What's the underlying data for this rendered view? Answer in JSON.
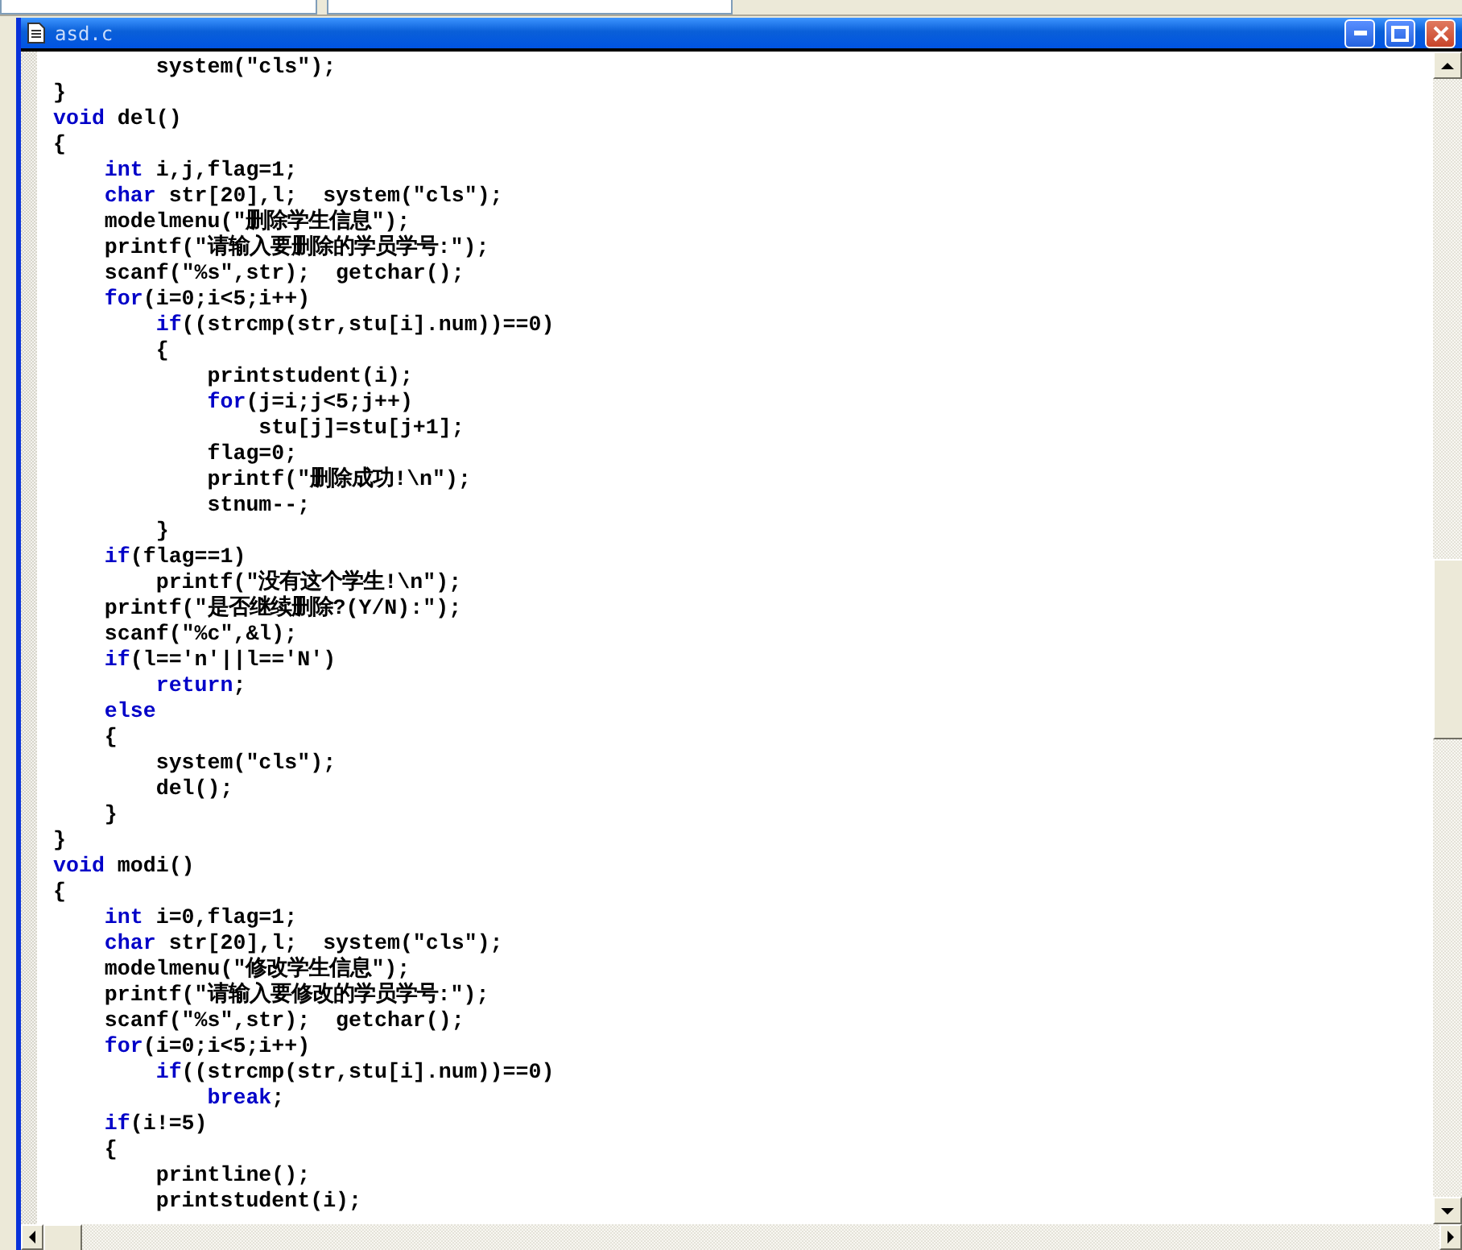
{
  "window": {
    "title": "asd.c"
  },
  "editor": {
    "lines": [
      {
        "tokens": [
          {
            "kind": "code",
            "text": "        system(\"cls\");"
          }
        ]
      },
      {
        "tokens": [
          {
            "kind": "code",
            "text": "}"
          }
        ]
      },
      {
        "tokens": [
          {
            "kind": "keyword",
            "text": "void"
          },
          {
            "kind": "code",
            "text": " del()"
          }
        ]
      },
      {
        "tokens": [
          {
            "kind": "code",
            "text": "{"
          }
        ]
      },
      {
        "tokens": [
          {
            "kind": "keyword",
            "text": "    int"
          },
          {
            "kind": "code",
            "text": " i,j,flag=1;"
          }
        ]
      },
      {
        "tokens": [
          {
            "kind": "keyword",
            "text": "    char"
          },
          {
            "kind": "code",
            "text": " str[20],l;  system(\"cls\");"
          }
        ]
      },
      {
        "tokens": [
          {
            "kind": "code",
            "text": "    modelmenu(\"删除学生信息\");"
          }
        ]
      },
      {
        "tokens": [
          {
            "kind": "code",
            "text": "    printf(\"请输入要删除的学员学号:\");"
          }
        ]
      },
      {
        "tokens": [
          {
            "kind": "code",
            "text": "    scanf(\"%s\",str);  getchar();"
          }
        ]
      },
      {
        "tokens": [
          {
            "kind": "keyword",
            "text": "    for"
          },
          {
            "kind": "code",
            "text": "(i=0;i<5;i++)"
          }
        ]
      },
      {
        "tokens": [
          {
            "kind": "keyword",
            "text": "        if"
          },
          {
            "kind": "code",
            "text": "((strcmp(str,stu[i].num))==0)"
          }
        ]
      },
      {
        "tokens": [
          {
            "kind": "code",
            "text": "        {"
          }
        ]
      },
      {
        "tokens": [
          {
            "kind": "code",
            "text": "            printstudent(i);"
          }
        ]
      },
      {
        "tokens": [
          {
            "kind": "keyword",
            "text": "            for"
          },
          {
            "kind": "code",
            "text": "(j=i;j<5;j++)"
          }
        ]
      },
      {
        "tokens": [
          {
            "kind": "code",
            "text": "                stu[j]=stu[j+1];"
          }
        ]
      },
      {
        "tokens": [
          {
            "kind": "code",
            "text": "            flag=0;"
          }
        ]
      },
      {
        "tokens": [
          {
            "kind": "code",
            "text": "            printf(\"删除成功!\\n\");"
          }
        ]
      },
      {
        "tokens": [
          {
            "kind": "code",
            "text": "            stnum--;"
          }
        ]
      },
      {
        "tokens": [
          {
            "kind": "code",
            "text": "        }"
          }
        ]
      },
      {
        "tokens": [
          {
            "kind": "keyword",
            "text": "    if"
          },
          {
            "kind": "code",
            "text": "(flag==1)"
          }
        ]
      },
      {
        "tokens": [
          {
            "kind": "code",
            "text": "        printf(\"没有这个学生!\\n\");"
          }
        ]
      },
      {
        "tokens": [
          {
            "kind": "code",
            "text": "    printf(\"是否继续删除?(Y/N):\");"
          }
        ]
      },
      {
        "tokens": [
          {
            "kind": "code",
            "text": "    scanf(\"%c\",&l);"
          }
        ]
      },
      {
        "tokens": [
          {
            "kind": "keyword",
            "text": "    if"
          },
          {
            "kind": "code",
            "text": "(l=='n'||l=='N')"
          }
        ]
      },
      {
        "tokens": [
          {
            "kind": "keyword",
            "text": "        return"
          },
          {
            "kind": "code",
            "text": ";"
          }
        ]
      },
      {
        "tokens": [
          {
            "kind": "keyword",
            "text": "    else"
          }
        ]
      },
      {
        "tokens": [
          {
            "kind": "code",
            "text": "    {"
          }
        ]
      },
      {
        "tokens": [
          {
            "kind": "code",
            "text": "        system(\"cls\");"
          }
        ]
      },
      {
        "tokens": [
          {
            "kind": "code",
            "text": "        del();"
          }
        ]
      },
      {
        "tokens": [
          {
            "kind": "code",
            "text": "    }"
          }
        ]
      },
      {
        "tokens": [
          {
            "kind": "code",
            "text": "}"
          }
        ]
      },
      {
        "tokens": [
          {
            "kind": "keyword",
            "text": "void"
          },
          {
            "kind": "code",
            "text": " modi()"
          }
        ]
      },
      {
        "tokens": [
          {
            "kind": "code",
            "text": "{"
          }
        ]
      },
      {
        "tokens": [
          {
            "kind": "keyword",
            "text": "    int"
          },
          {
            "kind": "code",
            "text": " i=0,flag=1;"
          }
        ]
      },
      {
        "tokens": [
          {
            "kind": "keyword",
            "text": "    char"
          },
          {
            "kind": "code",
            "text": " str[20],l;  system(\"cls\");"
          }
        ]
      },
      {
        "tokens": [
          {
            "kind": "code",
            "text": "    modelmenu(\"修改学生信息\");"
          }
        ]
      },
      {
        "tokens": [
          {
            "kind": "code",
            "text": "    printf(\"请输入要修改的学员学号:\");"
          }
        ]
      },
      {
        "tokens": [
          {
            "kind": "code",
            "text": "    scanf(\"%s\",str);  getchar();"
          }
        ]
      },
      {
        "tokens": [
          {
            "kind": "keyword",
            "text": "    for"
          },
          {
            "kind": "code",
            "text": "(i=0;i<5;i++)"
          }
        ]
      },
      {
        "tokens": [
          {
            "kind": "keyword",
            "text": "        if"
          },
          {
            "kind": "code",
            "text": "((strcmp(str,stu[i].num))==0)"
          }
        ]
      },
      {
        "tokens": [
          {
            "kind": "keyword",
            "text": "            break"
          },
          {
            "kind": "code",
            "text": ";"
          }
        ]
      },
      {
        "tokens": [
          {
            "kind": "keyword",
            "text": "    if"
          },
          {
            "kind": "code",
            "text": "(i!=5)"
          }
        ]
      },
      {
        "tokens": [
          {
            "kind": "code",
            "text": "    {"
          }
        ]
      },
      {
        "tokens": [
          {
            "kind": "code",
            "text": "        printline();"
          }
        ]
      },
      {
        "tokens": [
          {
            "kind": "code",
            "text": "        printstudent(i);"
          }
        ]
      }
    ]
  }
}
